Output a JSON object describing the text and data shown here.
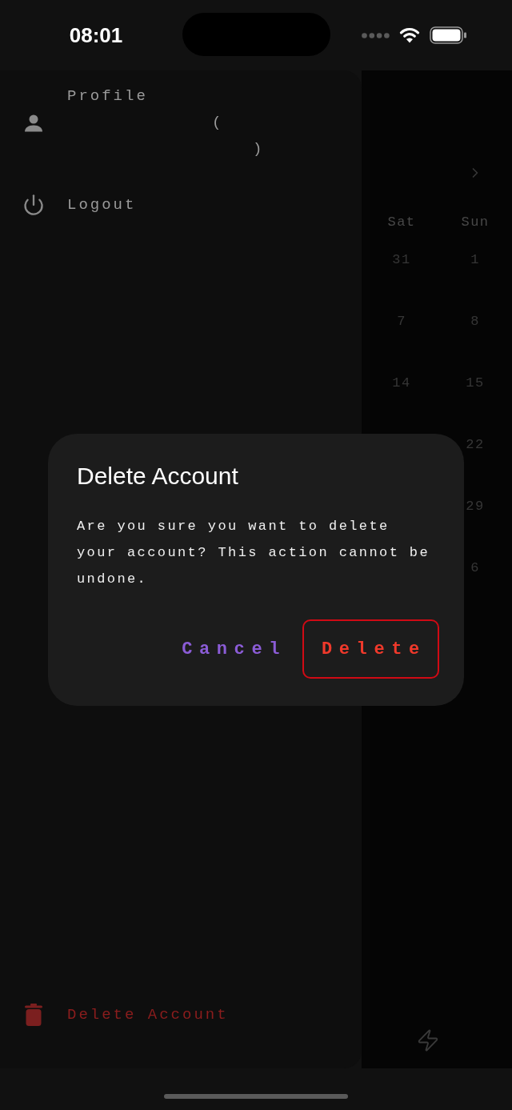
{
  "status_bar": {
    "time": "08:01"
  },
  "drawer": {
    "profile": {
      "label": "Profile",
      "lines": [
        "(",
        ")"
      ]
    },
    "items": [
      {
        "kind": "logout",
        "label": "Logout"
      }
    ],
    "danger_item": {
      "kind": "delete",
      "label": "Delete Account"
    }
  },
  "calendar": {
    "headers": [
      "Sat",
      "Sun"
    ],
    "weeks": [
      {
        "sat": "31",
        "sun": "1"
      },
      {
        "sat": "7",
        "sun": "8"
      },
      {
        "sat": "14",
        "sun": "15"
      },
      {
        "sun": "22"
      },
      {
        "sun": "29"
      },
      {
        "sun": "6"
      }
    ]
  },
  "dialog": {
    "title": "Delete Account",
    "message": "Are you sure you want to delete your account? This action cannot be undone.",
    "buttons": [
      {
        "kind": "cancel",
        "label": "Cancel"
      },
      {
        "kind": "destructive",
        "label": "Delete"
      }
    ]
  }
}
